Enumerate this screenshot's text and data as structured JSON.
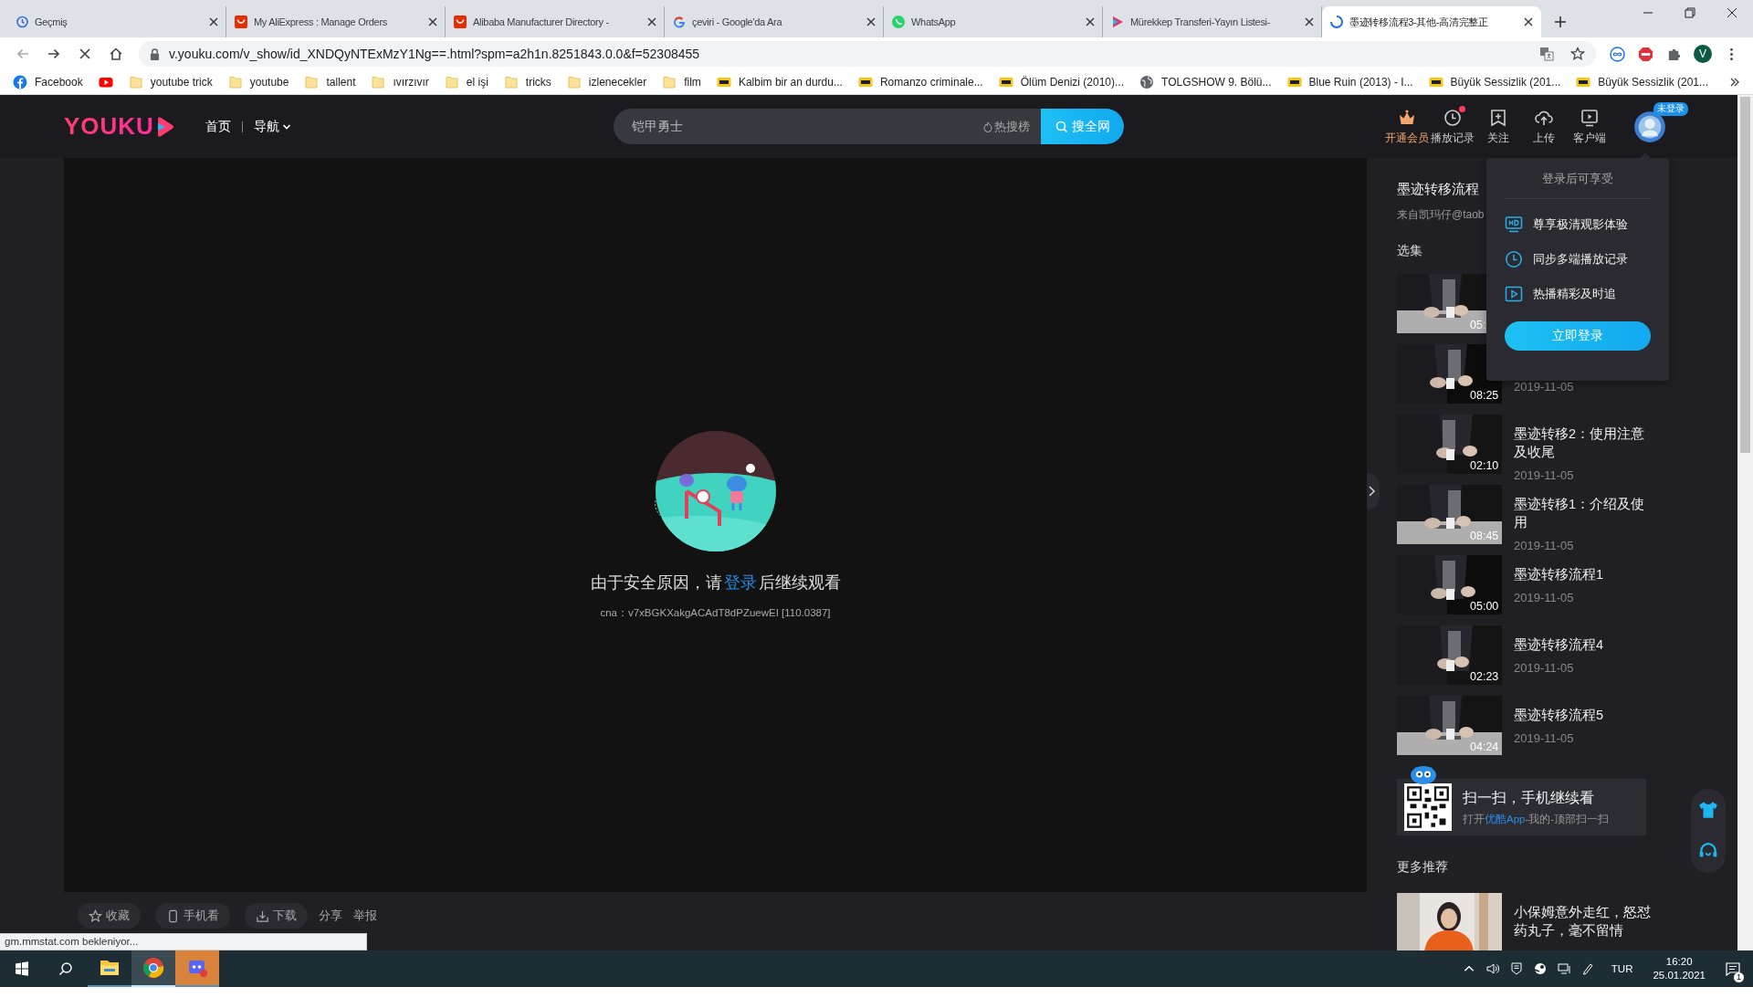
{
  "browser": {
    "tabs": [
      {
        "title": "Geçmiş",
        "kind": "history",
        "selected": false
      },
      {
        "title": "My AliExpress : Manage Orders",
        "kind": "bag",
        "selected": false
      },
      {
        "title": "Alibaba Manufacturer Directory -",
        "kind": "bag",
        "selected": false
      },
      {
        "title": "çeviri - Google'da Ara",
        "kind": "google",
        "selected": false
      },
      {
        "title": "WhatsApp",
        "kind": "whatsapp",
        "selected": false
      },
      {
        "title": "Mürekkep Transferi-Yayın Listesi-",
        "kind": "play",
        "selected": false
      },
      {
        "title": "墨迹转移流程3-其他-高清完整正",
        "kind": "loading",
        "selected": true
      }
    ],
    "address": "v.youku.com/v_show/id_XNDQyNTExMzY1Ng==.html?spm=a2h1n.8251843.0.0&f=52308455",
    "profile_initial": "V",
    "bookmarks": [
      {
        "label": "Facebook",
        "kind": "facebook"
      },
      {
        "kind": "youtube"
      },
      {
        "label": "youtube trick",
        "kind": "folder"
      },
      {
        "label": "youtube",
        "kind": "folder"
      },
      {
        "label": "tallent",
        "kind": "folder"
      },
      {
        "label": "ıvırzıvır",
        "kind": "folder"
      },
      {
        "label": "el işi",
        "kind": "folder"
      },
      {
        "label": "tricks",
        "kind": "folder"
      },
      {
        "label": "izlenecekler",
        "kind": "folder"
      },
      {
        "label": "film",
        "kind": "folder"
      },
      {
        "label": "Kalbim bir an durdu...",
        "kind": "imdb"
      },
      {
        "label": "Romanzo criminale...",
        "kind": "imdb"
      },
      {
        "label": "Ölüm Denizi (2010)...",
        "kind": "imdb"
      },
      {
        "label": "TOLGSHOW 9. Bölü...",
        "kind": "globe"
      },
      {
        "label": "Blue Ruin (2013) - I...",
        "kind": "imdb"
      },
      {
        "label": "Büyük Sessizlik (201...",
        "kind": "imdb"
      },
      {
        "label": "Büyük Sessizlik (201...",
        "kind": "imdb"
      }
    ]
  },
  "header": {
    "logo": "YOUKU",
    "nav": [
      {
        "label": "首页",
        "dropdown": false
      },
      {
        "label": "导航",
        "dropdown": true
      }
    ],
    "search": {
      "value": "铠甲勇士",
      "hot": "热搜榜",
      "button": "搜全网"
    },
    "actions": [
      {
        "label": "开通会员",
        "kind": "vip",
        "highlighted": true,
        "notification": false
      },
      {
        "label": "播放记录",
        "kind": "history",
        "highlighted": false,
        "notification": true
      },
      {
        "label": "关注",
        "kind": "follow",
        "highlighted": false,
        "notification": false
      },
      {
        "label": "上传",
        "kind": "upload",
        "highlighted": false,
        "notification": false
      },
      {
        "label": "客户端",
        "kind": "client",
        "highlighted": false,
        "notification": false
      }
    ],
    "avatar_badge": "未登录"
  },
  "player": {
    "message_before": "由于安全原因，请",
    "message_link": "登录",
    "message_after": "后继续观看",
    "code": "cna：v7xBGKXakgACAdT8dPZuewEI [110.0387]"
  },
  "player_actions": [
    {
      "label": "收藏",
      "kind": "star"
    },
    {
      "label": "手机看",
      "kind": "phone"
    },
    {
      "label": "下载",
      "kind": "download"
    },
    {
      "label": "分享",
      "kind": "text"
    },
    {
      "label": "举报",
      "kind": "text"
    }
  ],
  "sidebar": {
    "title": "墨迹转移流程",
    "source": "来自凯玛仔@taob",
    "section": "选集",
    "episodes": [
      {
        "duration": "05:"
      },
      {
        "date": "2019-11-05",
        "duration": "08:25"
      },
      {
        "title": "墨迹转移2：使用注意及收尾",
        "date": "2019-11-05",
        "duration": "02:10"
      },
      {
        "title": "墨迹转移1：介绍及使用",
        "date": "2019-11-05",
        "duration": "08:45"
      },
      {
        "title": "墨迹转移流程1",
        "date": "2019-11-05",
        "duration": "05:00"
      },
      {
        "title": "墨迹转移流程4",
        "date": "2019-11-05",
        "duration": "02:23"
      },
      {
        "title": "墨迹转移流程5",
        "date": "2019-11-05",
        "duration": "04:24"
      }
    ],
    "qr": {
      "title": "扫一扫，手机继续看",
      "text_before": "打开",
      "link": "优酷App",
      "text_after": "-我的-顶部扫一扫"
    },
    "more": "更多推荐",
    "recommended": [
      {
        "title": "小保姆意外走红，怒怼药丸子，毫不留情"
      }
    ]
  },
  "login_popup": {
    "heading": "登录后可享受",
    "items": [
      {
        "label": "尊享极清观影体验",
        "kind": "hd"
      },
      {
        "label": "同步多端播放记录",
        "kind": "clock"
      },
      {
        "label": "热播精彩及时追",
        "kind": "play"
      }
    ],
    "button": "立即登录"
  },
  "status_text": "gm.mmstat.com bekleniyor...",
  "taskbar": {
    "apps": [
      {
        "kind": "explorer",
        "selected": false,
        "flashing": false
      },
      {
        "kind": "chrome",
        "selected": true,
        "flashing": false
      },
      {
        "kind": "app",
        "selected": false,
        "flashing": true
      }
    ],
    "language": "TUR",
    "time": "16:20",
    "date": "25.01.2021",
    "notifications": "1"
  }
}
